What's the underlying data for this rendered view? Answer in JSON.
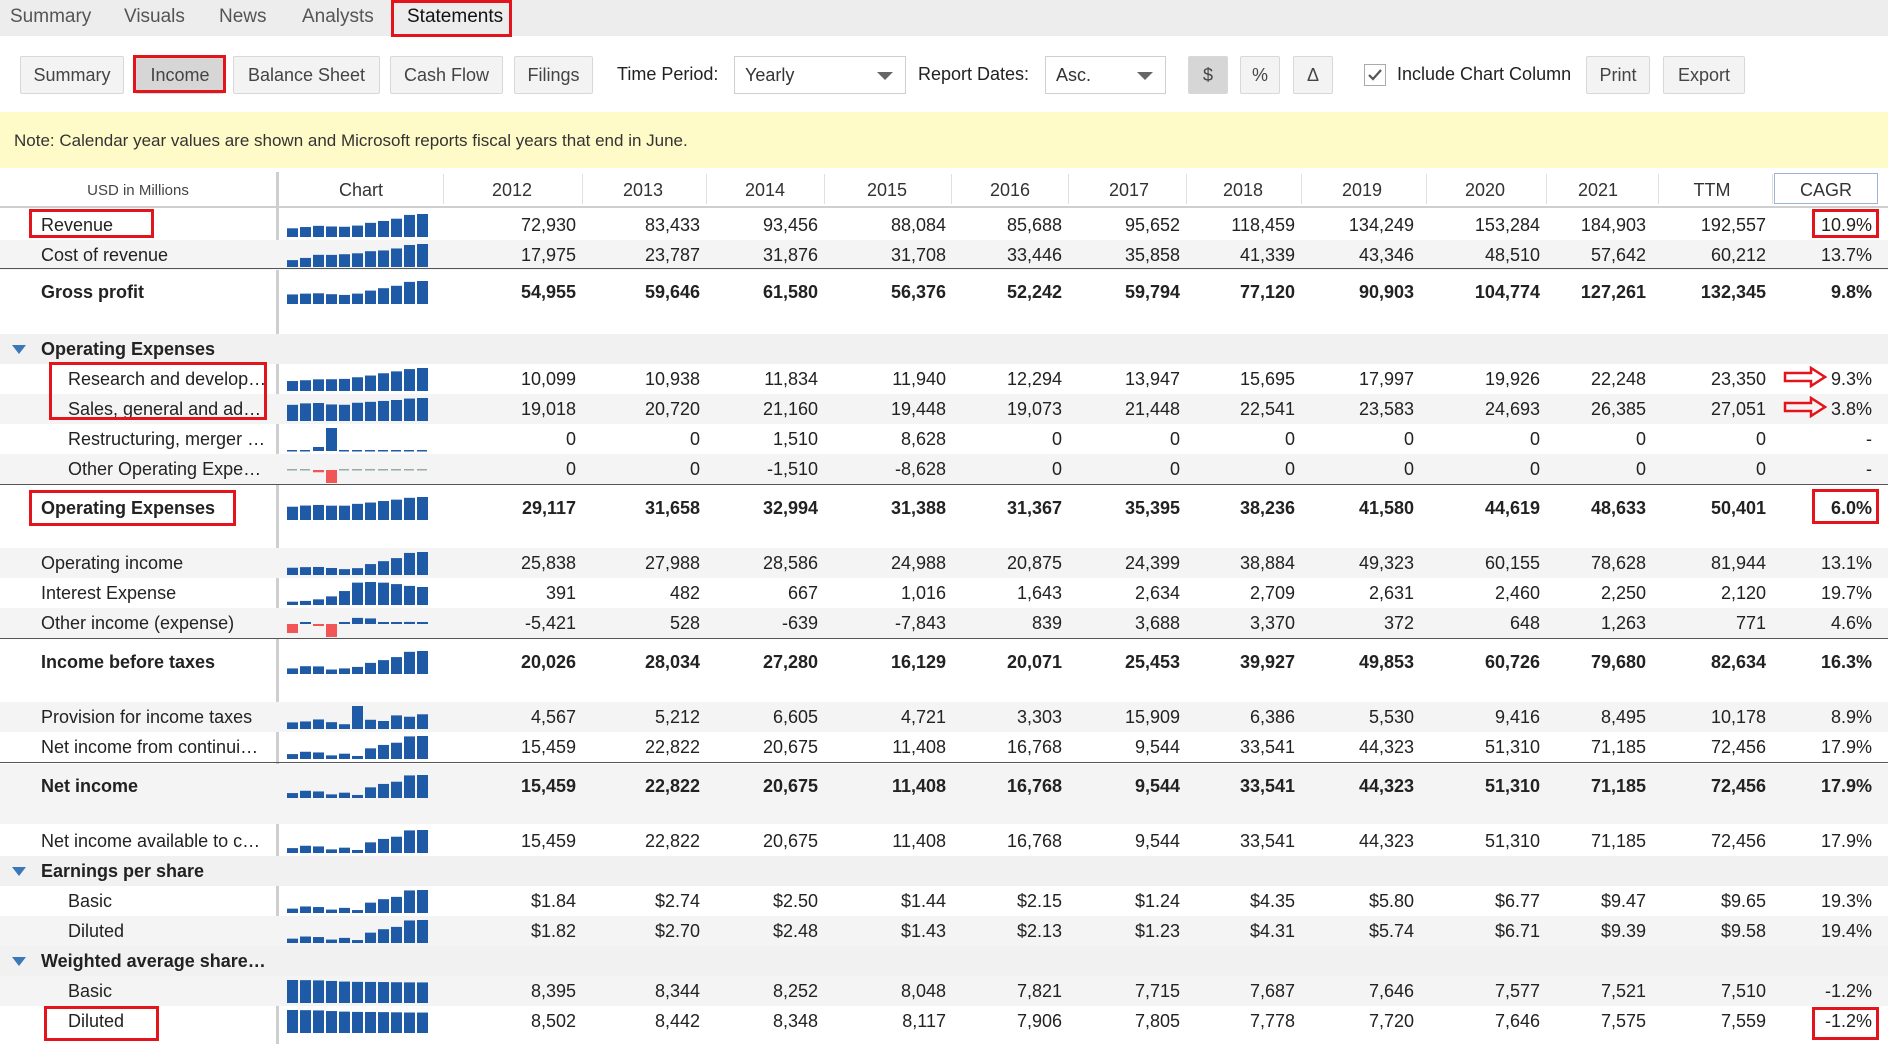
{
  "top_tabs": [
    "Summary",
    "Visuals",
    "News",
    "Analysts",
    "Statements"
  ],
  "sub_tabs": [
    "Summary",
    "Income",
    "Balance Sheet",
    "Cash Flow",
    "Filings"
  ],
  "toolbar": {
    "time_period_label": "Time Period:",
    "time_period_value": "Yearly",
    "report_dates_label": "Report Dates:",
    "report_dates_value": "Asc.",
    "unit_dollar": "$",
    "unit_percent": "%",
    "unit_delta": "Δ",
    "include_chart_label": "Include Chart Column",
    "print_label": "Print",
    "export_label": "Export"
  },
  "note": "Note: Calendar year values are shown and Microsoft reports fiscal years that end in June.",
  "table": {
    "units_label": "USD in Millions",
    "chart_header": "Chart",
    "columns": [
      "2012",
      "2013",
      "2014",
      "2015",
      "2016",
      "2017",
      "2018",
      "2019",
      "2020",
      "2021",
      "TTM",
      "CAGR"
    ],
    "rows": [
      {
        "label": "Revenue",
        "kind": "data",
        "bold": false,
        "indent": 0,
        "values": [
          "72,930",
          "83,433",
          "93,456",
          "88,084",
          "85,688",
          "95,652",
          "118,459",
          "134,249",
          "153,284",
          "184,903",
          "192,557",
          "10.9%"
        ]
      },
      {
        "label": "Cost of revenue",
        "kind": "data",
        "bold": false,
        "indent": 0,
        "values": [
          "17,975",
          "23,787",
          "31,876",
          "31,708",
          "33,446",
          "35,858",
          "41,339",
          "43,346",
          "48,510",
          "57,642",
          "60,212",
          "13.7%"
        ]
      },
      {
        "label": "Gross profit",
        "kind": "total",
        "bold": true,
        "indent": 0,
        "values": [
          "54,955",
          "59,646",
          "61,580",
          "56,376",
          "52,242",
          "59,794",
          "77,120",
          "90,903",
          "104,774",
          "127,261",
          "132,345",
          "9.8%"
        ]
      },
      {
        "label": "Operating Expenses",
        "kind": "group",
        "bold": true,
        "indent": 0,
        "values": []
      },
      {
        "label": "Research and development",
        "kind": "data",
        "bold": false,
        "indent": 1,
        "values": [
          "10,099",
          "10,938",
          "11,834",
          "11,940",
          "12,294",
          "13,947",
          "15,695",
          "17,997",
          "19,926",
          "22,248",
          "23,350",
          "9.3%"
        ]
      },
      {
        "label": "Sales, general and administrative",
        "kind": "data",
        "bold": false,
        "indent": 1,
        "values": [
          "19,018",
          "20,720",
          "21,160",
          "19,448",
          "19,073",
          "21,448",
          "22,541",
          "23,583",
          "24,693",
          "26,385",
          "27,051",
          "3.8%"
        ]
      },
      {
        "label": "Restructuring, merger and acquisition",
        "kind": "data",
        "bold": false,
        "indent": 1,
        "values": [
          "0",
          "0",
          "1,510",
          "8,628",
          "0",
          "0",
          "0",
          "0",
          "0",
          "0",
          "0",
          "-"
        ]
      },
      {
        "label": "Other Operating Expenses",
        "kind": "data",
        "bold": false,
        "indent": 1,
        "values": [
          "0",
          "0",
          "-1,510",
          "-8,628",
          "0",
          "0",
          "0",
          "0",
          "0",
          "0",
          "0",
          "-"
        ]
      },
      {
        "label": "Operating Expenses",
        "kind": "total",
        "bold": true,
        "indent": 0,
        "values": [
          "29,117",
          "31,658",
          "32,994",
          "31,388",
          "31,367",
          "35,395",
          "38,236",
          "41,580",
          "44,619",
          "48,633",
          "50,401",
          "6.0%"
        ]
      },
      {
        "label": "Operating income",
        "kind": "data",
        "bold": false,
        "indent": 0,
        "values": [
          "25,838",
          "27,988",
          "28,586",
          "24,988",
          "20,875",
          "24,399",
          "38,884",
          "49,323",
          "60,155",
          "78,628",
          "81,944",
          "13.1%"
        ]
      },
      {
        "label": "Interest Expense",
        "kind": "data",
        "bold": false,
        "indent": 0,
        "values": [
          "391",
          "482",
          "667",
          "1,016",
          "1,643",
          "2,634",
          "2,709",
          "2,631",
          "2,460",
          "2,250",
          "2,120",
          "19.7%"
        ]
      },
      {
        "label": "Other income (expense)",
        "kind": "data",
        "bold": false,
        "indent": 0,
        "values": [
          "-5,421",
          "528",
          "-639",
          "-7,843",
          "839",
          "3,688",
          "3,370",
          "372",
          "648",
          "1,263",
          "771",
          "4.6%"
        ]
      },
      {
        "label": "Income before taxes",
        "kind": "total",
        "bold": true,
        "indent": 0,
        "values": [
          "20,026",
          "28,034",
          "27,280",
          "16,129",
          "20,071",
          "25,453",
          "39,927",
          "49,853",
          "60,726",
          "79,680",
          "82,634",
          "16.3%"
        ]
      },
      {
        "label": "Provision for income taxes",
        "kind": "data",
        "bold": false,
        "indent": 0,
        "values": [
          "4,567",
          "5,212",
          "6,605",
          "4,721",
          "3,303",
          "15,909",
          "6,386",
          "5,530",
          "9,416",
          "8,495",
          "10,178",
          "8.9%"
        ]
      },
      {
        "label": "Net income from continuing operations",
        "kind": "data",
        "bold": false,
        "indent": 0,
        "values": [
          "15,459",
          "22,822",
          "20,675",
          "11,408",
          "16,768",
          "9,544",
          "33,541",
          "44,323",
          "51,310",
          "71,185",
          "72,456",
          "17.9%"
        ]
      },
      {
        "label": "Net income",
        "kind": "total",
        "bold": true,
        "indent": 0,
        "values": [
          "15,459",
          "22,822",
          "20,675",
          "11,408",
          "16,768",
          "9,544",
          "33,541",
          "44,323",
          "51,310",
          "71,185",
          "72,456",
          "17.9%"
        ]
      },
      {
        "label": "Net income available to common shareholders",
        "kind": "data",
        "bold": false,
        "indent": 0,
        "values": [
          "15,459",
          "22,822",
          "20,675",
          "11,408",
          "16,768",
          "9,544",
          "33,541",
          "44,323",
          "51,310",
          "71,185",
          "72,456",
          "17.9%"
        ]
      },
      {
        "label": "Earnings per share",
        "kind": "group",
        "bold": true,
        "indent": 0,
        "values": []
      },
      {
        "label": "Basic",
        "kind": "data",
        "bold": false,
        "indent": 1,
        "values": [
          "$1.84",
          "$2.74",
          "$2.50",
          "$1.44",
          "$2.15",
          "$1.24",
          "$4.35",
          "$5.80",
          "$6.77",
          "$9.47",
          "$9.65",
          "19.3%"
        ]
      },
      {
        "label": "Diluted",
        "kind": "data",
        "bold": false,
        "indent": 1,
        "values": [
          "$1.82",
          "$2.70",
          "$2.48",
          "$1.43",
          "$2.13",
          "$1.23",
          "$4.31",
          "$5.74",
          "$6.71",
          "$9.39",
          "$9.58",
          "19.4%"
        ]
      },
      {
        "label": "Weighted average shares outstanding",
        "kind": "group",
        "bold": true,
        "indent": 0,
        "values": []
      },
      {
        "label": "Basic",
        "kind": "data",
        "bold": false,
        "indent": 1,
        "values": [
          "8,395",
          "8,344",
          "8,252",
          "8,048",
          "7,821",
          "7,715",
          "7,687",
          "7,646",
          "7,577",
          "7,521",
          "7,510",
          "-1.2%"
        ]
      },
      {
        "label": "Diluted",
        "kind": "data",
        "bold": false,
        "indent": 1,
        "values": [
          "8,502",
          "8,442",
          "8,348",
          "8,117",
          "7,906",
          "7,805",
          "7,778",
          "7,720",
          "7,646",
          "7,575",
          "7,559",
          "-1.2%"
        ]
      }
    ]
  },
  "colors": {
    "bar_positive": "#1f5aa6",
    "bar_negative": "#f25555",
    "highlight": "#e2151d",
    "note_bg": "#fffbc8"
  }
}
